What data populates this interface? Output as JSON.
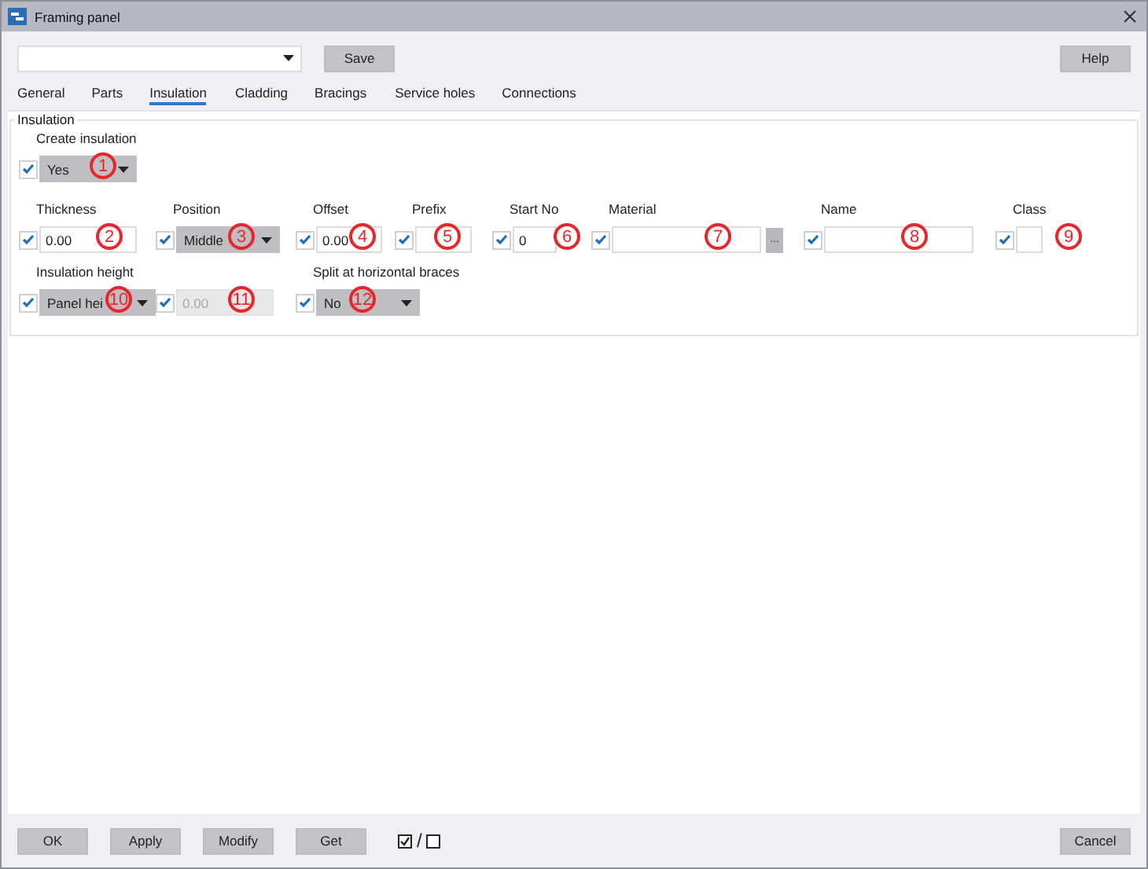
{
  "window": {
    "title": "Framing panel"
  },
  "top_bar": {
    "save": "Save",
    "help": "Help"
  },
  "tabs": [
    {
      "label": "General",
      "selected": false
    },
    {
      "label": "Parts",
      "selected": false
    },
    {
      "label": "Insulation",
      "selected": true
    },
    {
      "label": "Cladding",
      "selected": false
    },
    {
      "label": "Bracings",
      "selected": false
    },
    {
      "label": "Service holes",
      "selected": false
    },
    {
      "label": "Connections",
      "selected": false
    }
  ],
  "group": {
    "title": "Insulation",
    "rows": [
      [
        {
          "label": "Create insulation",
          "kind": "combo",
          "value": "Yes",
          "checked": true,
          "disabled": false,
          "callout": "1"
        }
      ],
      [
        {
          "label": "Thickness",
          "kind": "input",
          "value": "0.00",
          "checked": true,
          "disabled": false,
          "callout": "2"
        },
        {
          "label": "Position",
          "kind": "combo",
          "value": "Middle",
          "checked": true,
          "disabled": false,
          "callout": "3"
        },
        {
          "label": "Offset",
          "kind": "input",
          "value": "0.00",
          "checked": true,
          "disabled": false,
          "callout": "4"
        },
        {
          "label": "Prefix",
          "kind": "input",
          "checked": true,
          "disabled": false,
          "callout": "5"
        },
        {
          "label": "Start No",
          "kind": "input",
          "value": "0",
          "checked": true,
          "disabled": false,
          "callout": "6"
        },
        {
          "label": "Material",
          "kind": "browse",
          "button": "...",
          "checked": true,
          "disabled": false,
          "callout": "7"
        },
        {
          "label": "Name",
          "kind": "input",
          "checked": true,
          "disabled": false,
          "callout": "8"
        },
        {
          "label": "Class",
          "kind": "input",
          "checked": true,
          "disabled": false,
          "callout": "9"
        }
      ],
      [
        {
          "label": "Insulation height",
          "kind": "combo",
          "value": "Panel hei",
          "checked": true,
          "disabled": false,
          "callout": "10"
        },
        {
          "kind": "input",
          "value": "0.00",
          "checked": true,
          "disabled": true,
          "callout": "11"
        },
        {
          "label": "Split at horizontal braces",
          "kind": "combo",
          "value": "No",
          "checked": true,
          "disabled": false,
          "callout": "12"
        }
      ]
    ]
  },
  "bottom_bar": {
    "buttons": [
      "OK",
      "Apply",
      "Modify",
      "Get"
    ],
    "toggle_separator": "/",
    "cancel": "Cancel"
  }
}
